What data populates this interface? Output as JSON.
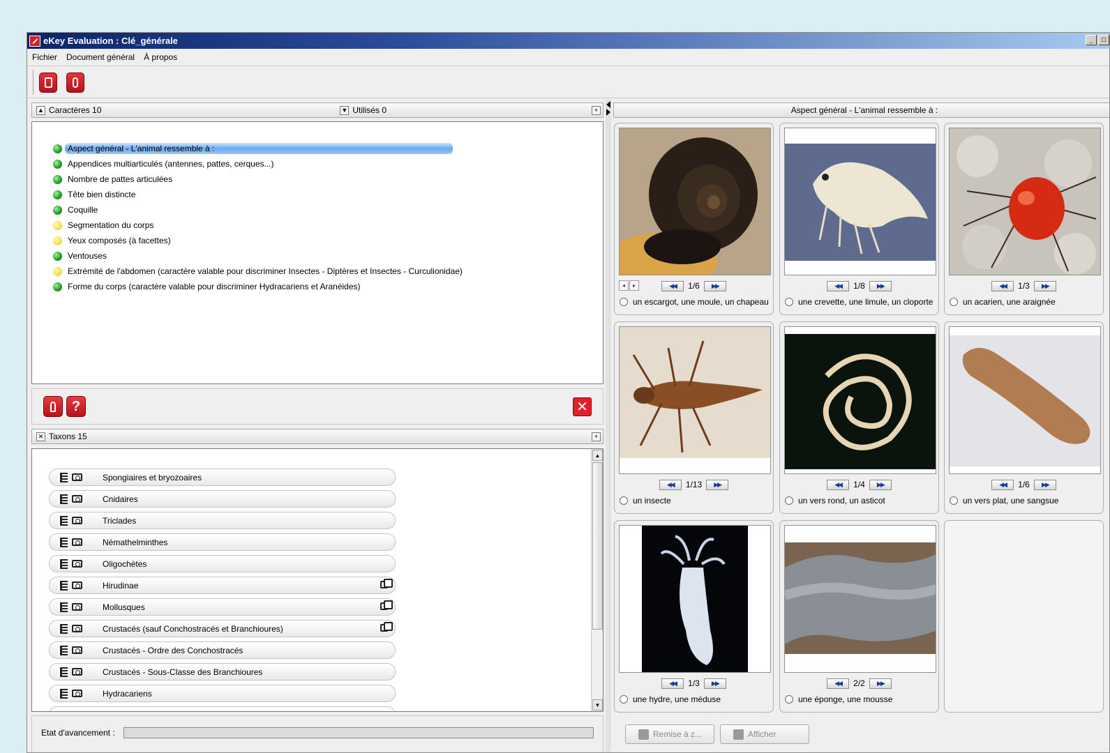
{
  "window": {
    "title": "eKey Evaluation : Clé_générale"
  },
  "menu": {
    "items": [
      "Fichier",
      "Document général",
      "À propos"
    ]
  },
  "characters_header": {
    "label": "Caractères 10",
    "used_label": "Utilisés 0"
  },
  "characters": [
    {
      "label": "Aspect général - L'animal ressemble à :",
      "status": "green",
      "selected": true
    },
    {
      "label": "Appendices multiarticulés (antennes, pattes, cerques...)",
      "status": "green"
    },
    {
      "label": "Nombre de pattes articulées",
      "status": "green"
    },
    {
      "label": "Tête bien distincte",
      "status": "green"
    },
    {
      "label": "Coquille",
      "status": "green"
    },
    {
      "label": "Segmentation du corps",
      "status": "yellow"
    },
    {
      "label": "Yeux composés (à facettes)",
      "status": "yellow"
    },
    {
      "label": "Ventouses",
      "status": "green"
    },
    {
      "label": "Extrémité de l'abdomen (caractère valable pour discriminer Insectes - Diptères et Insectes - Curculionidae)",
      "status": "yellow"
    },
    {
      "label": "Forme du corps (caractère valable pour discriminer Hydracariens et Aranéides)",
      "status": "green"
    }
  ],
  "actions": {
    "help_label": "?"
  },
  "taxa_header": {
    "label": "Taxons 15"
  },
  "taxa": [
    {
      "label": "Spongiaires et bryozoaires",
      "copy": false
    },
    {
      "label": "Cnidaires",
      "copy": false
    },
    {
      "label": "Triclades",
      "copy": false
    },
    {
      "label": "Némathelminthes",
      "copy": false
    },
    {
      "label": "Oligochètes",
      "copy": false
    },
    {
      "label": "Hirudinae",
      "copy": true
    },
    {
      "label": "Mollusques",
      "copy": true
    },
    {
      "label": "Crustacés (sauf Conchostracés et Branchioures)",
      "copy": true
    },
    {
      "label": "Crustacés - Ordre des Conchostracés",
      "copy": false
    },
    {
      "label": "Crustacés - Sous-Classe des Branchioures",
      "copy": false
    },
    {
      "label": "Hydracariens",
      "copy": false
    }
  ],
  "progress": {
    "label": "Etat d'avancement :",
    "value": 0
  },
  "right_header": {
    "label": "Aspect général - L'animal ressemble à :"
  },
  "states": [
    {
      "label": "un escargot, une moule, un chapeau c",
      "counter": "1/6",
      "image": "snail-image"
    },
    {
      "label": "une crevette, une limule, un cloporte",
      "counter": "1/8",
      "image": "shrimp-image"
    },
    {
      "label": "un acarien, une araignée",
      "counter": "1/3",
      "image": "mite-image"
    },
    {
      "label": "un insecte",
      "counter": "1/13",
      "image": "insect-image"
    },
    {
      "label": "un vers rond, un asticot",
      "counter": "1/4",
      "image": "roundworm-image"
    },
    {
      "label": "un vers plat, une sangsue",
      "counter": "1/6",
      "image": "flatworm-image"
    },
    {
      "label": "une hydre, une méduse",
      "counter": "1/3",
      "image": "hydra-image"
    },
    {
      "label": "une éponge, une mousse",
      "counter": "2/2",
      "image": "sponge-image"
    }
  ],
  "bottom_buttons": {
    "reset_label": "Remise à z...",
    "show_label": "Afficher"
  },
  "icons": {
    "window_min": "_",
    "window_max": "□",
    "collapse": "▲",
    "dropdown": "▼",
    "expand": "+",
    "close": "✕"
  },
  "colors": {
    "status_green": "#1f9a1f",
    "status_yellow": "#f2e34a",
    "accent_red": "#d4202a",
    "selection_blue": "#6aa8ec"
  }
}
